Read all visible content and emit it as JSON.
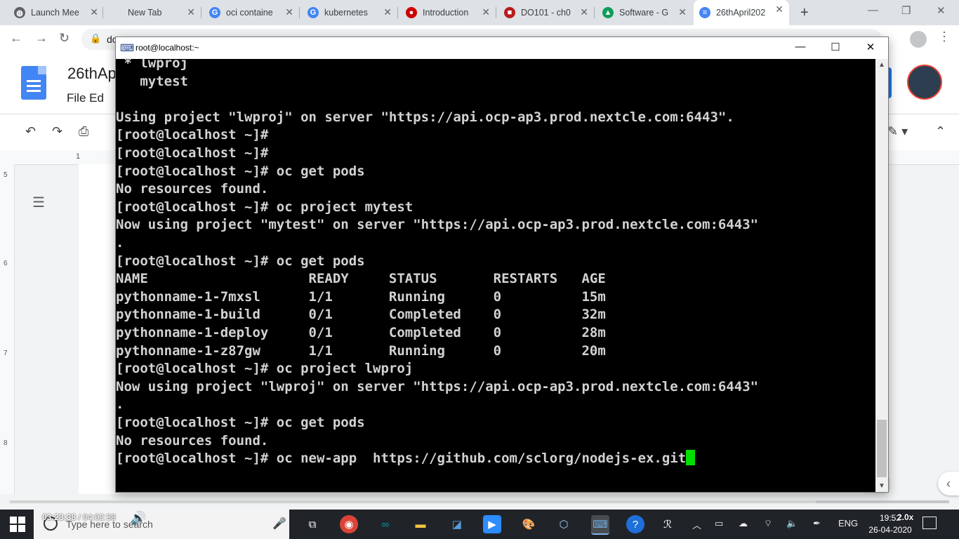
{
  "browser": {
    "tabs": [
      {
        "label": "Launch Mee",
        "icon": "globe-icon",
        "color": "#5f6368",
        "glyph": "◍"
      },
      {
        "label": "New Tab",
        "icon": "none",
        "color": "#dee1e6",
        "glyph": ""
      },
      {
        "label": "oci containe",
        "icon": "google-icon",
        "color": "#4285f4",
        "glyph": "G"
      },
      {
        "label": "kubernetes",
        "icon": "google-icon",
        "color": "#4285f4",
        "glyph": "G"
      },
      {
        "label": "Introduction",
        "icon": "redhat-icon",
        "color": "#cc0000",
        "glyph": "●"
      },
      {
        "label": "DO101 - ch0",
        "icon": "redhat-icon",
        "color": "#b71c1c",
        "glyph": "■"
      },
      {
        "label": "Software - G",
        "icon": "drive-icon",
        "color": "#0f9d58",
        "glyph": "▲"
      },
      {
        "label": "26thApril202",
        "icon": "docs-icon",
        "color": "#4285f4",
        "glyph": "≡"
      }
    ],
    "new_tab": "+",
    "address": "do"
  },
  "docs": {
    "title": "26thAp",
    "menu": "File   Ed",
    "ruler_mark": "1",
    "left_ruler": [
      "5",
      "6",
      "7",
      "8"
    ]
  },
  "putty": {
    "title": "root@localhost:~",
    "lines": [
      " * lwproj",
      "   mytest",
      "",
      "Using project \"lwproj\" on server \"https://api.ocp-ap3.prod.nextcle.com:6443\".",
      "[root@localhost ~]#",
      "[root@localhost ~]#",
      "[root@localhost ~]# oc get pods",
      "No resources found.",
      "[root@localhost ~]# oc project mytest",
      "Now using project \"mytest\" on server \"https://api.ocp-ap3.prod.nextcle.com:6443\"",
      ".",
      "[root@localhost ~]# oc get pods",
      "NAME                    READY     STATUS       RESTARTS   AGE",
      "pythonname-1-7mxsl      1/1       Running      0          15m",
      "pythonname-1-build      0/1       Completed    0          32m",
      "pythonname-1-deploy     0/1       Completed    0          28m",
      "pythonname-1-z87gw      1/1       Running      0          20m",
      "[root@localhost ~]# oc project lwproj",
      "Now using project \"lwproj\" on server \"https://api.ocp-ap3.prod.nextcle.com:6443\"",
      ".",
      "[root@localhost ~]# oc get pods",
      "No resources found.",
      "[root@localhost ~]# oc new-app  https://github.com/sclorg/nodejs-ex.git"
    ]
  },
  "video": {
    "current_time": "03:23:38",
    "total_time": " / 04:02:38",
    "speed": "2.0x",
    "progress_played": 0,
    "progress_buffered": 0.858
  },
  "taskbar": {
    "search_placeholder": "Type here to search",
    "language": "ENG",
    "time": "19:52",
    "date": "26-04-2020"
  }
}
